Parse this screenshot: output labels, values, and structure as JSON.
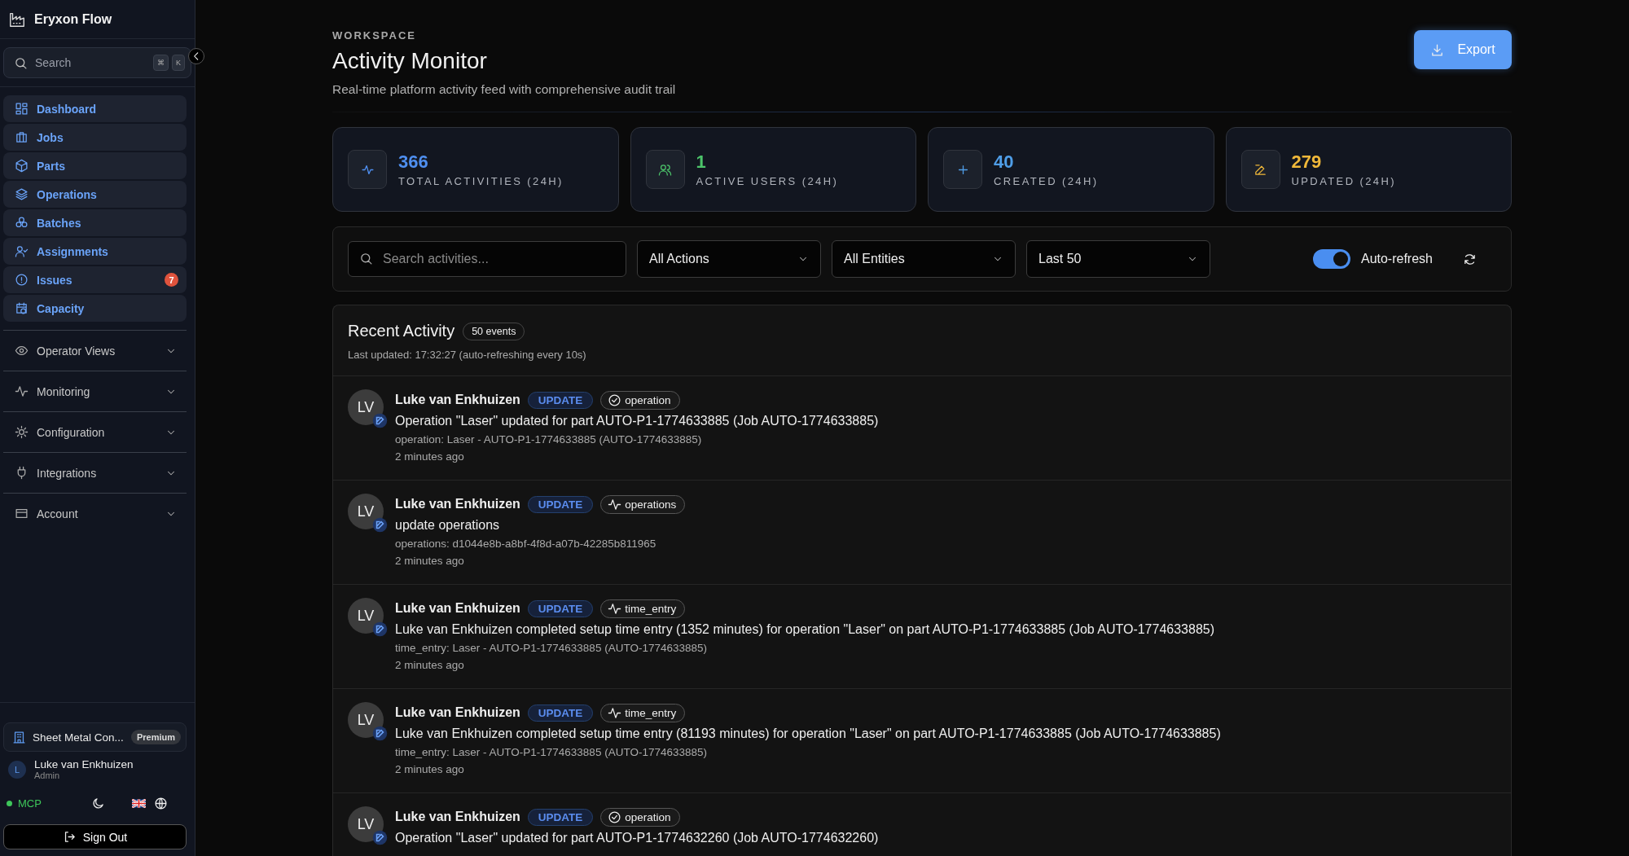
{
  "sidebar": {
    "brand": "Eryxon Flow",
    "search": {
      "placeholder": "Search",
      "keys": [
        "⌘",
        "K"
      ]
    },
    "nav": [
      {
        "label": "Dashboard"
      },
      {
        "label": "Jobs"
      },
      {
        "label": "Parts"
      },
      {
        "label": "Operations"
      },
      {
        "label": "Batches"
      },
      {
        "label": "Assignments"
      },
      {
        "label": "Issues",
        "badge": "7"
      },
      {
        "label": "Capacity"
      }
    ],
    "groups": [
      {
        "label": "Operator Views",
        "expanded": false
      },
      {
        "label": "Monitoring",
        "expanded": false
      },
      {
        "label": "Configuration",
        "expanded": false
      },
      {
        "label": "Integrations",
        "expanded": false
      },
      {
        "label": "Account",
        "expanded": false
      }
    ],
    "org": {
      "name": "Sheet Metal Con...",
      "plan": "Premium"
    },
    "user": {
      "initial": "L",
      "name": "Luke van Enkhuizen",
      "role": "Admin"
    },
    "status": {
      "label": "MCP",
      "online": true
    },
    "sign_out": "Sign Out"
  },
  "header": {
    "eyebrow": "WORKSPACE",
    "title": "Activity Monitor",
    "subtitle": "Real-time platform activity feed with comprehensive audit trail",
    "export": "Export"
  },
  "stats": [
    {
      "value": "366",
      "label": "TOTAL ACTIVITIES (24H)",
      "color": "#4f8ff0"
    },
    {
      "value": "1",
      "label": "ACTIVE USERS (24H)",
      "color": "#4cc46a"
    },
    {
      "value": "40",
      "label": "CREATED (24H)",
      "color": "#4f9ee8"
    },
    {
      "value": "279",
      "label": "UPDATED (24H)",
      "color": "#f0b83a"
    }
  ],
  "filters": {
    "search": {
      "placeholder": "Search activities..."
    },
    "selects": [
      {
        "value": "All Actions"
      },
      {
        "value": "All Entities"
      },
      {
        "value": "Last 50"
      }
    ],
    "auto_refresh": {
      "label": "Auto-refresh",
      "on": true
    }
  },
  "activity": {
    "title": "Recent Activity",
    "count": "50 events",
    "last_updated": "Last updated: 17:32:27 (auto-refreshing every 10s)",
    "items": [
      {
        "initials": "LV",
        "user": "Luke van Enkhuizen",
        "action": "UPDATE",
        "entity": "operation",
        "kind": "check",
        "message": "Operation \"Laser\" updated for part AUTO-P1-1774633885 (Job AUTO-1774633885)",
        "detail": "operation: Laser - AUTO-P1-1774633885 (AUTO-1774633885)",
        "time": "2 minutes ago"
      },
      {
        "initials": "LV",
        "user": "Luke van Enkhuizen",
        "action": "UPDATE",
        "entity": "operations",
        "kind": "pulse",
        "message": "update operations",
        "detail": "operations: d1044e8b-a8bf-4f8d-a07b-42285b811965",
        "time": "2 minutes ago"
      },
      {
        "initials": "LV",
        "user": "Luke van Enkhuizen",
        "action": "UPDATE",
        "entity": "time_entry",
        "kind": "pulse",
        "message": "Luke van Enkhuizen completed setup time entry (1352 minutes) for operation \"Laser\" on part AUTO-P1-1774633885 (Job AUTO-1774633885)",
        "detail": "time_entry: Laser - AUTO-P1-1774633885 (AUTO-1774633885)",
        "time": "2 minutes ago"
      },
      {
        "initials": "LV",
        "user": "Luke van Enkhuizen",
        "action": "UPDATE",
        "entity": "time_entry",
        "kind": "pulse",
        "message": "Luke van Enkhuizen completed setup time entry (81193 minutes) for operation \"Laser\" on part AUTO-P1-1774633885 (Job AUTO-1774633885)",
        "detail": "time_entry: Laser - AUTO-P1-1774633885 (AUTO-1774633885)",
        "time": "2 minutes ago"
      },
      {
        "initials": "LV",
        "user": "Luke van Enkhuizen",
        "action": "UPDATE",
        "entity": "operation",
        "kind": "check",
        "message": "Operation \"Laser\" updated for part AUTO-P1-1774632260 (Job AUTO-1774632260)"
      }
    ]
  }
}
